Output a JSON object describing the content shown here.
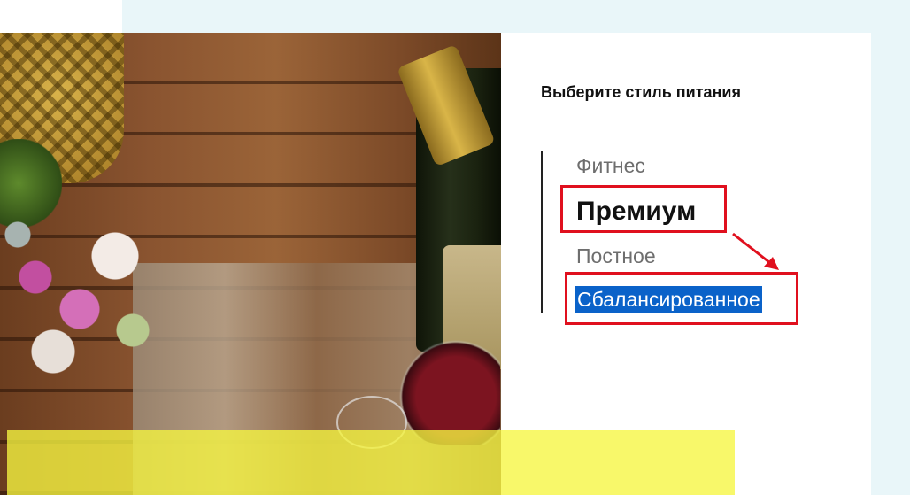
{
  "section": {
    "title": "Выберите стиль питания"
  },
  "diet_options": [
    {
      "label": "Фитнес",
      "state": "default"
    },
    {
      "label": "Премиум",
      "state": "active"
    },
    {
      "label": "Постное",
      "state": "default"
    },
    {
      "label": "Сбалансированное",
      "state": "text-selected"
    }
  ],
  "colors": {
    "page_background": "#e9f6f9",
    "card_background": "#ffffff",
    "annotation_red": "#e0101e",
    "selection_blue": "#0a62c9",
    "overlay_yellow": "#f6f640"
  }
}
